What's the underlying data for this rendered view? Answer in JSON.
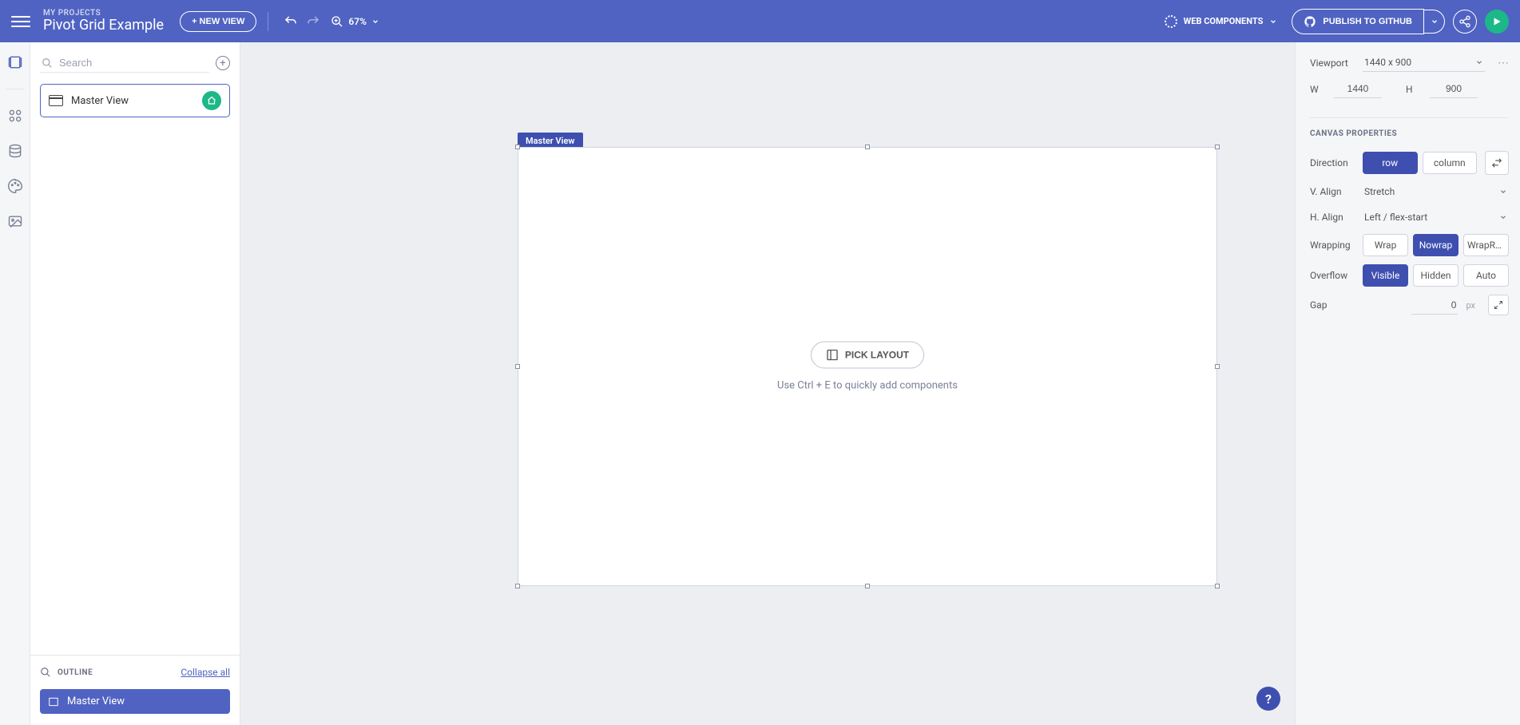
{
  "header": {
    "projects_label": "MY PROJECTS",
    "project_title": "Pivot Grid Example",
    "new_view": "+ NEW VIEW",
    "zoom": "67%",
    "framework": "WEB COMPONENTS",
    "publish": "PUBLISH TO GITHUB"
  },
  "left": {
    "search_placeholder": "Search",
    "views": [
      {
        "label": "Master View",
        "is_home": true
      }
    ],
    "outline_title": "OUTLINE",
    "collapse": "Collapse all",
    "outline_items": [
      {
        "label": "Master View"
      }
    ]
  },
  "canvas": {
    "tag": "Master View",
    "pick_layout": "PICK LAYOUT",
    "hint": "Use Ctrl + E to quickly add components",
    "help": "?"
  },
  "right": {
    "viewport_label": "Viewport",
    "viewport_value": "1440 x 900",
    "w_label": "W",
    "w_value": "1440",
    "h_label": "H",
    "h_value": "900",
    "section_title": "CANVAS PROPERTIES",
    "direction_label": "Direction",
    "direction_options": [
      "row",
      "column"
    ],
    "direction_active": "row",
    "valign_label": "V. Align",
    "valign_value": "Stretch",
    "halign_label": "H. Align",
    "halign_value": "Left / flex-start",
    "wrapping_label": "Wrapping",
    "wrapping_options": [
      "Wrap",
      "Nowrap",
      "WrapRe..."
    ],
    "wrapping_active": "Nowrap",
    "overflow_label": "Overflow",
    "overflow_options": [
      "Visible",
      "Hidden",
      "Auto"
    ],
    "overflow_active": "Visible",
    "gap_label": "Gap",
    "gap_value": "0",
    "gap_unit": "px"
  }
}
